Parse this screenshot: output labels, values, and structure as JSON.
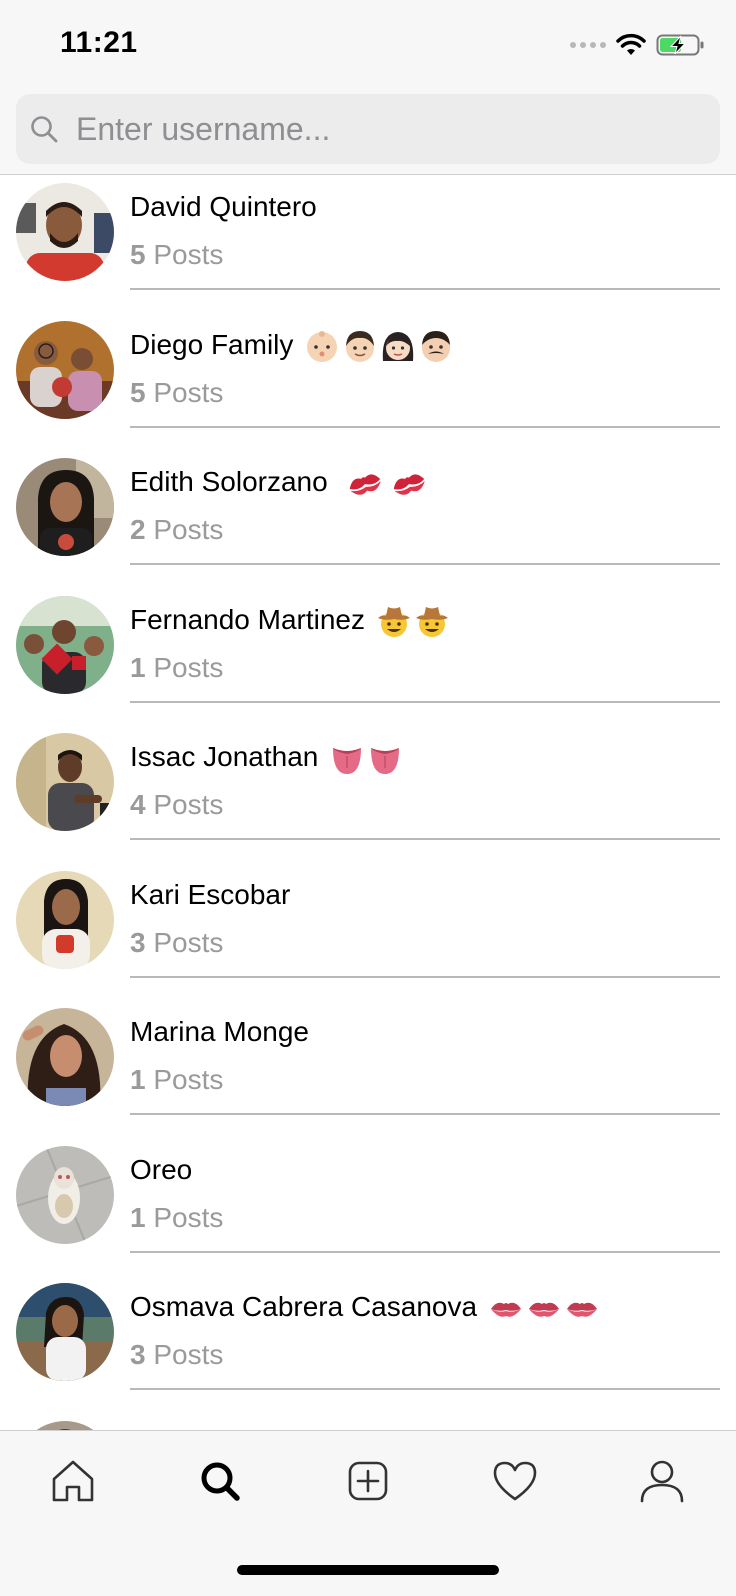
{
  "status_bar": {
    "time": "11:21"
  },
  "search": {
    "placeholder": "Enter username..."
  },
  "users": [
    {
      "name": "David Quintero",
      "emoji": [],
      "post_count": "5",
      "posts_label": "Posts"
    },
    {
      "name": "Diego Family",
      "emoji": [
        "baby-emoji",
        "boy-emoji",
        "woman-emoji",
        "man-mustache-emoji"
      ],
      "post_count": "5",
      "posts_label": "Posts"
    },
    {
      "name": "Edith Solorzano",
      "emoji": [
        "kiss-mark-emoji",
        "kiss-mark-emoji"
      ],
      "post_count": "2",
      "posts_label": "Posts"
    },
    {
      "name": "Fernando Martinez",
      "emoji": [
        "cowboy-emoji",
        "cowboy-emoji"
      ],
      "post_count": "1",
      "posts_label": "Posts"
    },
    {
      "name": "Issac Jonathan",
      "emoji": [
        "tongue-emoji",
        "tongue-emoji"
      ],
      "post_count": "4",
      "posts_label": "Posts"
    },
    {
      "name": "Kari Escobar",
      "emoji": [],
      "post_count": "3",
      "posts_label": "Posts"
    },
    {
      "name": "Marina Monge",
      "emoji": [],
      "post_count": "1",
      "posts_label": "Posts"
    },
    {
      "name": "Oreo",
      "emoji": [],
      "post_count": "1",
      "posts_label": "Posts"
    },
    {
      "name": "Osmava Cabrera Casanova",
      "emoji": [
        "lips-emoji",
        "lips-emoji",
        "lips-emoji"
      ],
      "post_count": "3",
      "posts_label": "Posts"
    }
  ],
  "tab_bar": {
    "tabs": [
      {
        "icon": "home-icon",
        "active": false
      },
      {
        "icon": "search-icon",
        "active": true
      },
      {
        "icon": "add-post-icon",
        "active": false
      },
      {
        "icon": "heart-icon",
        "active": false
      },
      {
        "icon": "profile-icon",
        "active": false
      }
    ]
  },
  "colors": {
    "inactive_icon": "#333333",
    "active_icon": "#000000",
    "secondary_text": "#9a9a9a",
    "battery_fill": "#4cd964"
  }
}
